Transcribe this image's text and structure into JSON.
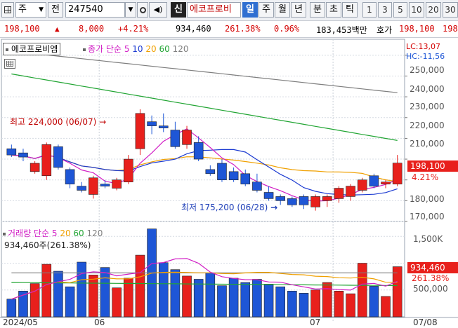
{
  "toolbar": {
    "market": "주",
    "period_label": "전",
    "code": "247540",
    "credit_badge": "신",
    "stock_name": "에코프로비",
    "tabs": [
      {
        "label": "일",
        "selected": true
      },
      {
        "label": "주",
        "selected": false
      },
      {
        "label": "월",
        "selected": false
      },
      {
        "label": "년",
        "selected": false
      },
      {
        "label": "분",
        "selected": false
      },
      {
        "label": "초",
        "selected": false
      },
      {
        "label": "틱",
        "selected": false
      }
    ],
    "intervals": [
      "1",
      "3",
      "5",
      "10",
      "20",
      "30"
    ]
  },
  "price_bar": {
    "price": "198,100",
    "change": "8,000",
    "change_pct": "+4.21%",
    "volume": "934,460",
    "volume_pct": "261.38%",
    "turnover": "0.96%",
    "amount": "183,453백만",
    "quote_label": "호가",
    "quote_price": "198,100",
    "quote_price_cut": "198"
  },
  "chart": {
    "title": "에코프로비엠",
    "ma_legend": {
      "label": "종가 단순",
      "periods": [
        "5",
        "10",
        "20",
        "60",
        "120"
      ]
    },
    "lc": "LC:13,07",
    "hc": "HC:-11,56",
    "price_axis": [
      "250,000",
      "240,000",
      "230,000",
      "220,000",
      "210,000",
      "180,000",
      "170,000"
    ],
    "current_price_tag": "198,100",
    "current_pct_tag": "4.21%",
    "high_annotation": "최고 224,000 (06/07)",
    "low_annotation": "최저 175,200 (06/28)",
    "volume_legend": {
      "label": "거래량 단순",
      "periods": [
        "5",
        "20",
        "60",
        "120"
      ]
    },
    "volume_info": "934,460주(261.38%)",
    "volume_axis": [
      "1,500K",
      "500,000"
    ],
    "current_volume_tag": "934,460",
    "current_volume_pct_tag": "261.38%",
    "date_axis": [
      "2024/05",
      "06",
      "07",
      "07/08"
    ]
  },
  "colors": {
    "up": "#e8201c",
    "down": "#1e56d6",
    "ma5": "#d11ec5",
    "ma10": "#1b3ad1",
    "ma20": "#f0a000",
    "ma60": "#22a534",
    "ma120": "#7f7f7f"
  },
  "chart_data": {
    "type": "candlestick",
    "ylim": [
      170000,
      255000
    ],
    "candles": [
      {
        "o": 205000,
        "h": 207000,
        "l": 201000,
        "c": 202000
      },
      {
        "o": 203000,
        "h": 205000,
        "l": 199000,
        "c": 201000
      },
      {
        "o": 194000,
        "h": 199000,
        "l": 193000,
        "c": 198000
      },
      {
        "o": 192000,
        "h": 208000,
        "l": 190000,
        "c": 207000
      },
      {
        "o": 206000,
        "h": 207000,
        "l": 195000,
        "c": 196000
      },
      {
        "o": 195000,
        "h": 196000,
        "l": 186000,
        "c": 188000
      },
      {
        "o": 187000,
        "h": 189000,
        "l": 184000,
        "c": 185000
      },
      {
        "o": 183000,
        "h": 192000,
        "l": 181000,
        "c": 191000
      },
      {
        "o": 188000,
        "h": 190000,
        "l": 186000,
        "c": 187000
      },
      {
        "o": 186000,
        "h": 191000,
        "l": 185000,
        "c": 190000
      },
      {
        "o": 189000,
        "h": 202000,
        "l": 188000,
        "c": 200000
      },
      {
        "o": 205000,
        "h": 224000,
        "l": 202000,
        "c": 222000
      },
      {
        "o": 218000,
        "h": 221000,
        "l": 212000,
        "c": 216000
      },
      {
        "o": 216000,
        "h": 222000,
        "l": 213000,
        "c": 215000
      },
      {
        "o": 214000,
        "h": 218000,
        "l": 205000,
        "c": 206000
      },
      {
        "o": 207000,
        "h": 216000,
        "l": 205000,
        "c": 214000
      },
      {
        "o": 208000,
        "h": 211000,
        "l": 199000,
        "c": 200000
      },
      {
        "o": 195000,
        "h": 197000,
        "l": 192000,
        "c": 193000
      },
      {
        "o": 198000,
        "h": 200000,
        "l": 189000,
        "c": 190000
      },
      {
        "o": 194000,
        "h": 196000,
        "l": 189000,
        "c": 190000
      },
      {
        "o": 193000,
        "h": 195000,
        "l": 187000,
        "c": 188000
      },
      {
        "o": 189000,
        "h": 193000,
        "l": 184000,
        "c": 185000
      },
      {
        "o": 184000,
        "h": 187000,
        "l": 180000,
        "c": 181000
      },
      {
        "o": 182000,
        "h": 183000,
        "l": 178000,
        "c": 180000
      },
      {
        "o": 181000,
        "h": 182000,
        "l": 177000,
        "c": 178000
      },
      {
        "o": 182000,
        "h": 183000,
        "l": 176000,
        "c": 178000
      },
      {
        "o": 177000,
        "h": 183000,
        "l": 175200,
        "c": 182000
      },
      {
        "o": 180000,
        "h": 183000,
        "l": 177000,
        "c": 182000
      },
      {
        "o": 181000,
        "h": 187000,
        "l": 179000,
        "c": 186000
      },
      {
        "o": 182000,
        "h": 188000,
        "l": 180000,
        "c": 187000
      },
      {
        "o": 185000,
        "h": 191000,
        "l": 184000,
        "c": 190000
      },
      {
        "o": 192000,
        "h": 193000,
        "l": 186000,
        "c": 187000
      },
      {
        "o": 188000,
        "h": 190000,
        "l": 186000,
        "c": 189000
      },
      {
        "o": 188000,
        "h": 202000,
        "l": 187000,
        "c": 198100
      }
    ],
    "volumes": [
      330000,
      480000,
      620000,
      980000,
      850000,
      560000,
      1020000,
      780000,
      920000,
      540000,
      720000,
      1150000,
      1640000,
      1010000,
      880000,
      760000,
      700000,
      820000,
      580000,
      720000,
      640000,
      700000,
      610000,
      560000,
      480000,
      440000,
      500000,
      640000,
      480000,
      430000,
      1000000,
      570000,
      380000,
      934460
    ],
    "vlim": [
      0,
      1700000
    ]
  }
}
